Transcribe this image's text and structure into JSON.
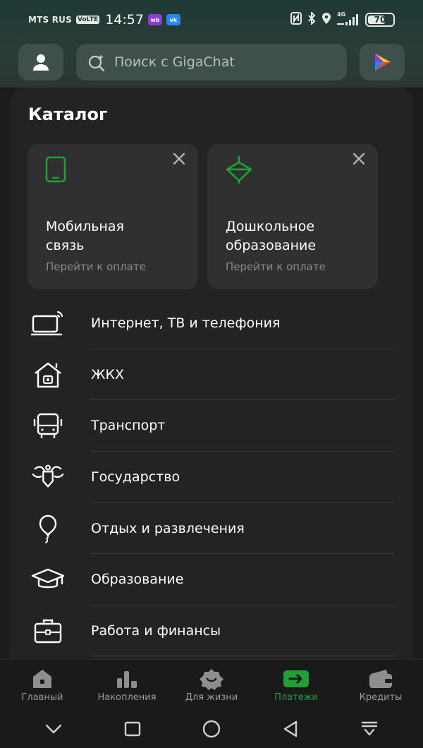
{
  "status_bar": {
    "carrier": "MTS RUS",
    "volte": "VoLTE",
    "time": "14:57",
    "badges": [
      {
        "text": "wb",
        "color": "#8b3bd6"
      },
      {
        "text": "vk",
        "color": "#2787f5"
      }
    ],
    "network": "4G",
    "battery": "70",
    "battery_level": 0.7
  },
  "header": {
    "search_placeholder": "Поиск с GigaChat"
  },
  "catalog": {
    "title": "Каталог",
    "tiles": [
      {
        "title": "Мобильная\nсвязь",
        "subtitle": "Перейти к оплате",
        "icon": "phone-icon"
      },
      {
        "title": "Дошкольное\nобразование",
        "subtitle": "Перейти к оплате",
        "icon": "spinning-top-icon"
      }
    ],
    "items": [
      {
        "label": "Интернет, ТВ и телефония",
        "icon": "internet-tv-icon"
      },
      {
        "label": "ЖКХ",
        "icon": "house-icon"
      },
      {
        "label": "Транспорт",
        "icon": "bus-icon"
      },
      {
        "label": "Государство",
        "icon": "emblem-icon"
      },
      {
        "label": "Отдых и развлечения",
        "icon": "balloon-icon"
      },
      {
        "label": "Образование",
        "icon": "graduation-cap-icon"
      },
      {
        "label": "Работа и финансы",
        "icon": "briefcase-icon"
      }
    ]
  },
  "bottom_nav": {
    "items": [
      {
        "label": "Главный",
        "icon": "home-icon"
      },
      {
        "label": "Накопления",
        "icon": "bars-icon"
      },
      {
        "label": "Для жизни",
        "icon": "smile-icon"
      },
      {
        "label": "Платежи",
        "icon": "payments-icon"
      },
      {
        "label": "Кредиты",
        "icon": "wallet-icon"
      }
    ],
    "active_index": 3
  },
  "colors": {
    "accent": "#21a038",
    "background": "#1c1c1c",
    "card": "#232323",
    "tile": "#303030",
    "muted_text": "#8a8a8a"
  }
}
